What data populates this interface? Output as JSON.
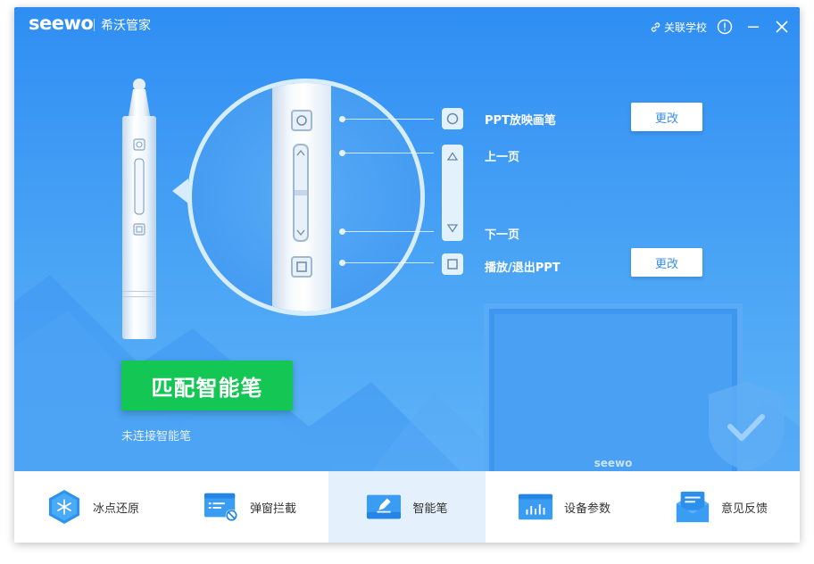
{
  "titlebar": {
    "logo": "seewo",
    "app_name": "希沃管家",
    "link_school": "关联学校",
    "link_icon": "link-icon",
    "info_icon": "info-icon",
    "minimize_icon": "minimize-icon",
    "close_icon": "close-icon"
  },
  "pen_keys": [
    {
      "label": "PPT放映画笔",
      "icon": "circle-key-icon",
      "change": "更改"
    },
    {
      "label": "上一页",
      "icon": "triangle-up-icon"
    },
    {
      "label": "下一页",
      "icon": "triangle-down-icon"
    },
    {
      "label": "播放/退出PPT",
      "icon": "square-key-icon",
      "change": "更改"
    }
  ],
  "match_button": "匹配智能笔",
  "status_text": "未连接智能笔",
  "monitor_logo": "seewo",
  "tabs": [
    {
      "label": "冰点还原",
      "icon": "snowflake-hexagon-icon",
      "active": false
    },
    {
      "label": "弹窗拦截",
      "icon": "popup-block-icon",
      "active": false
    },
    {
      "label": "智能笔",
      "icon": "smart-pen-icon",
      "active": true
    },
    {
      "label": "设备参数",
      "icon": "device-stats-icon",
      "active": false
    },
    {
      "label": "意见反馈",
      "icon": "feedback-mail-icon",
      "active": false
    }
  ],
  "colors": {
    "hero_top": "#2f8ef3",
    "hero_bottom": "#5fb4f8",
    "match_button": "#14c654",
    "change_text": "#3b8ee8",
    "active_tab": "#e4f0fb"
  }
}
